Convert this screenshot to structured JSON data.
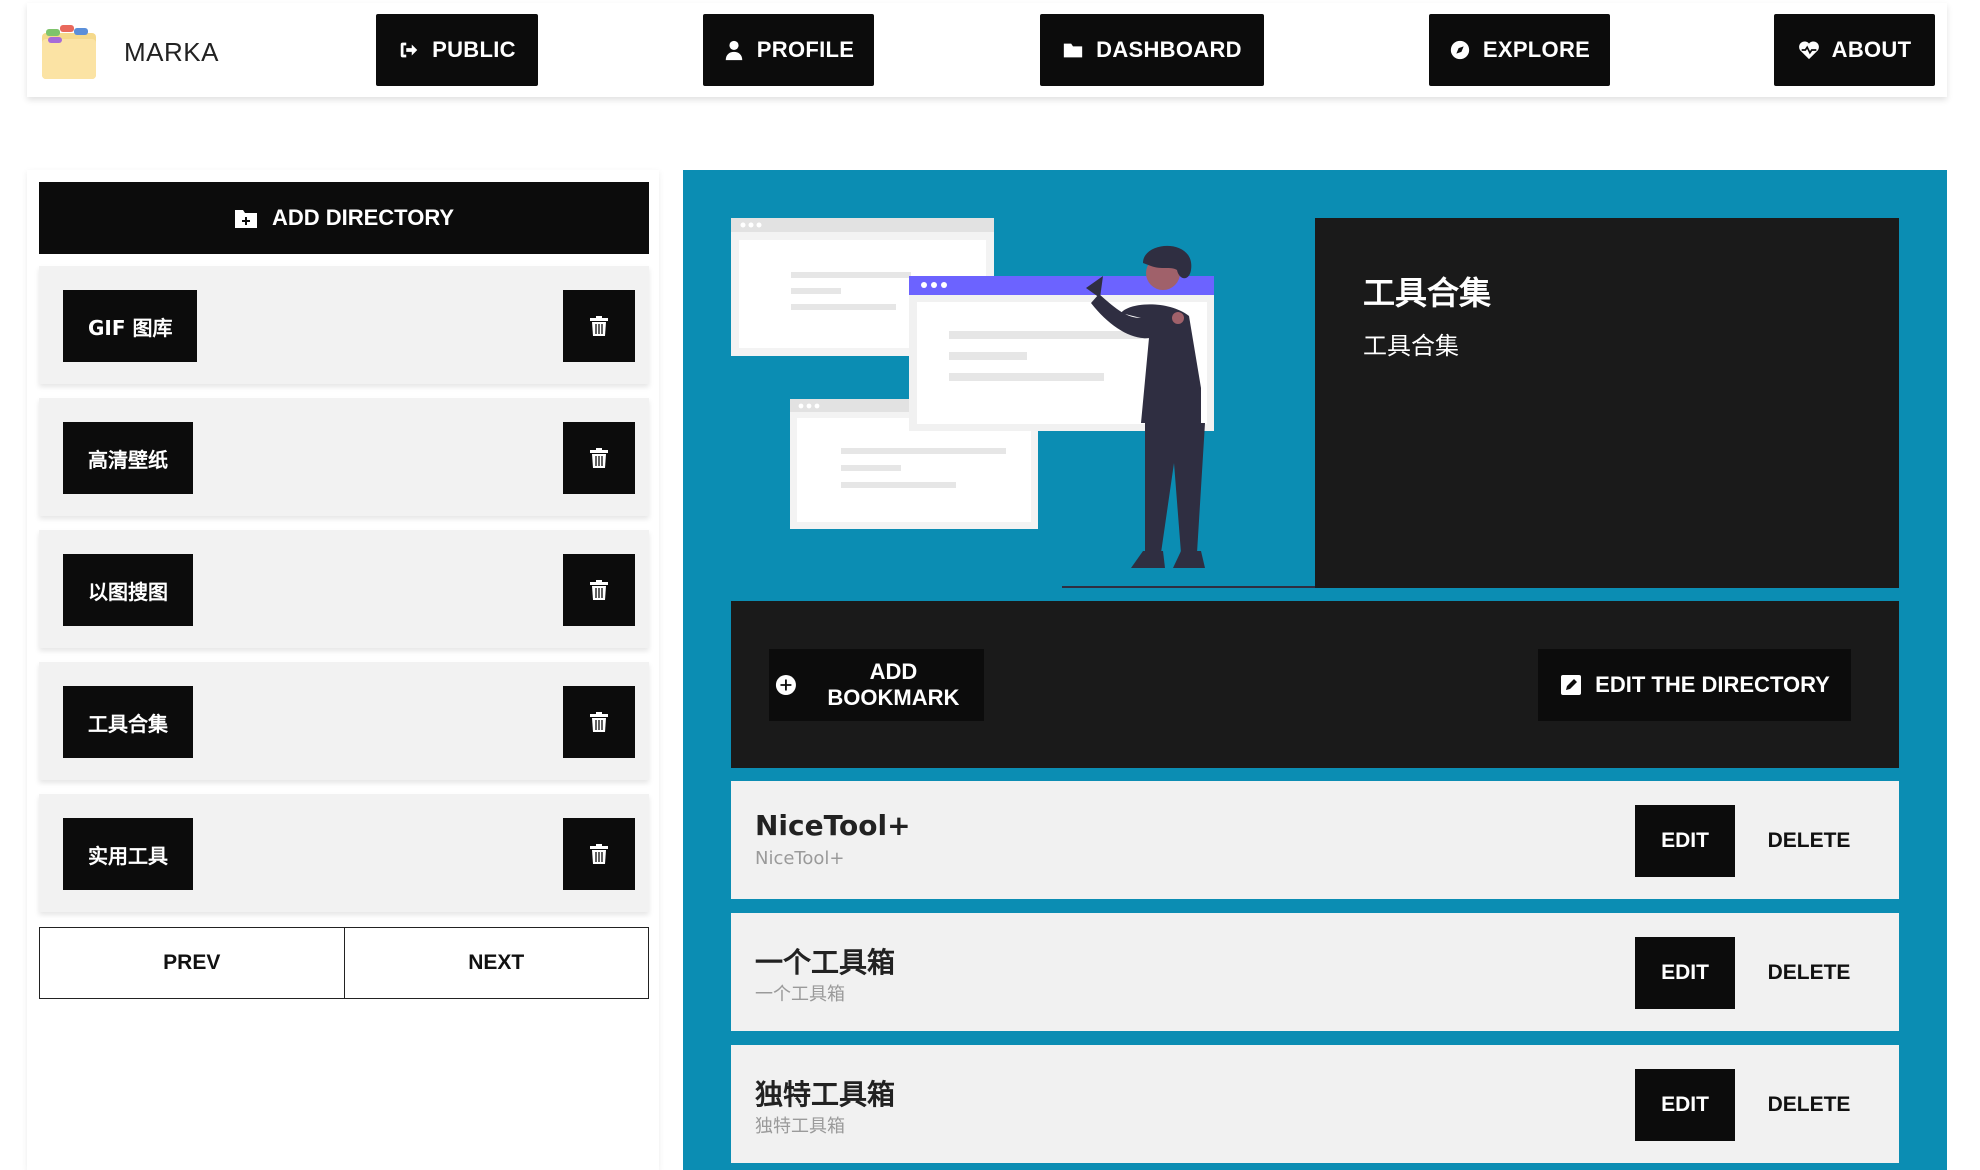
{
  "navbar": {
    "brand": "MARKA",
    "links": [
      {
        "label": "PUBLIC",
        "icon": "sign-out-icon"
      },
      {
        "label": "PROFILE",
        "icon": "user-icon"
      },
      {
        "label": "DASHBOARD",
        "icon": "folder-icon"
      },
      {
        "label": "EXPLORE",
        "icon": "compass-icon"
      },
      {
        "label": "ABOUT",
        "icon": "heartbeat-icon"
      }
    ]
  },
  "sidebar": {
    "add_directory_label": "ADD DIRECTORY",
    "directories": [
      {
        "name": "GIF 图库"
      },
      {
        "name": "高清壁纸"
      },
      {
        "name": "以图搜图"
      },
      {
        "name": "工具合集"
      },
      {
        "name": "实用工具"
      }
    ],
    "prev_label": "PREV",
    "next_label": "NEXT"
  },
  "main": {
    "directory": {
      "title": "工具合集",
      "description": "工具合集"
    },
    "add_bookmark_label": "ADD BOOKMARK",
    "edit_directory_label": "EDIT THE DIRECTORY",
    "bookmarks": [
      {
        "title": "NiceTool+",
        "subtitle": "NiceTool+",
        "edit_label": "EDIT",
        "delete_label": "DELETE"
      },
      {
        "title": "一个工具箱",
        "subtitle": "一个工具箱",
        "edit_label": "EDIT",
        "delete_label": "DELETE"
      },
      {
        "title": "独特工具箱",
        "subtitle": "独特工具箱",
        "edit_label": "EDIT",
        "delete_label": "DELETE"
      }
    ]
  },
  "colors": {
    "accent_teal": "#0b8db3",
    "button_black": "#0c0c0c",
    "card_dark": "#1a1a1a",
    "row_light": "#f1f1f1",
    "illustration_purple": "#6c63ff"
  }
}
